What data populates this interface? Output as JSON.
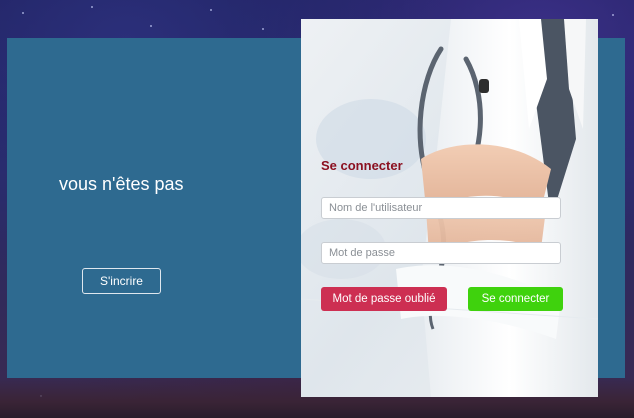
{
  "left_panel": {
    "message": "vous n'êtes pas",
    "signup_label": "S'incrire"
  },
  "login_card": {
    "title": "Se connecter",
    "username_placeholder": "Nom de l'utilisateur",
    "password_placeholder": "Mot de passe",
    "forgot_label": "Mot de passe oublié",
    "connect_label": "Se connecter"
  },
  "colors": {
    "panel": "#2e6a90",
    "title": "#8b1020",
    "forgot_button": "#cd2f52",
    "connect_button": "#3fd20d"
  }
}
